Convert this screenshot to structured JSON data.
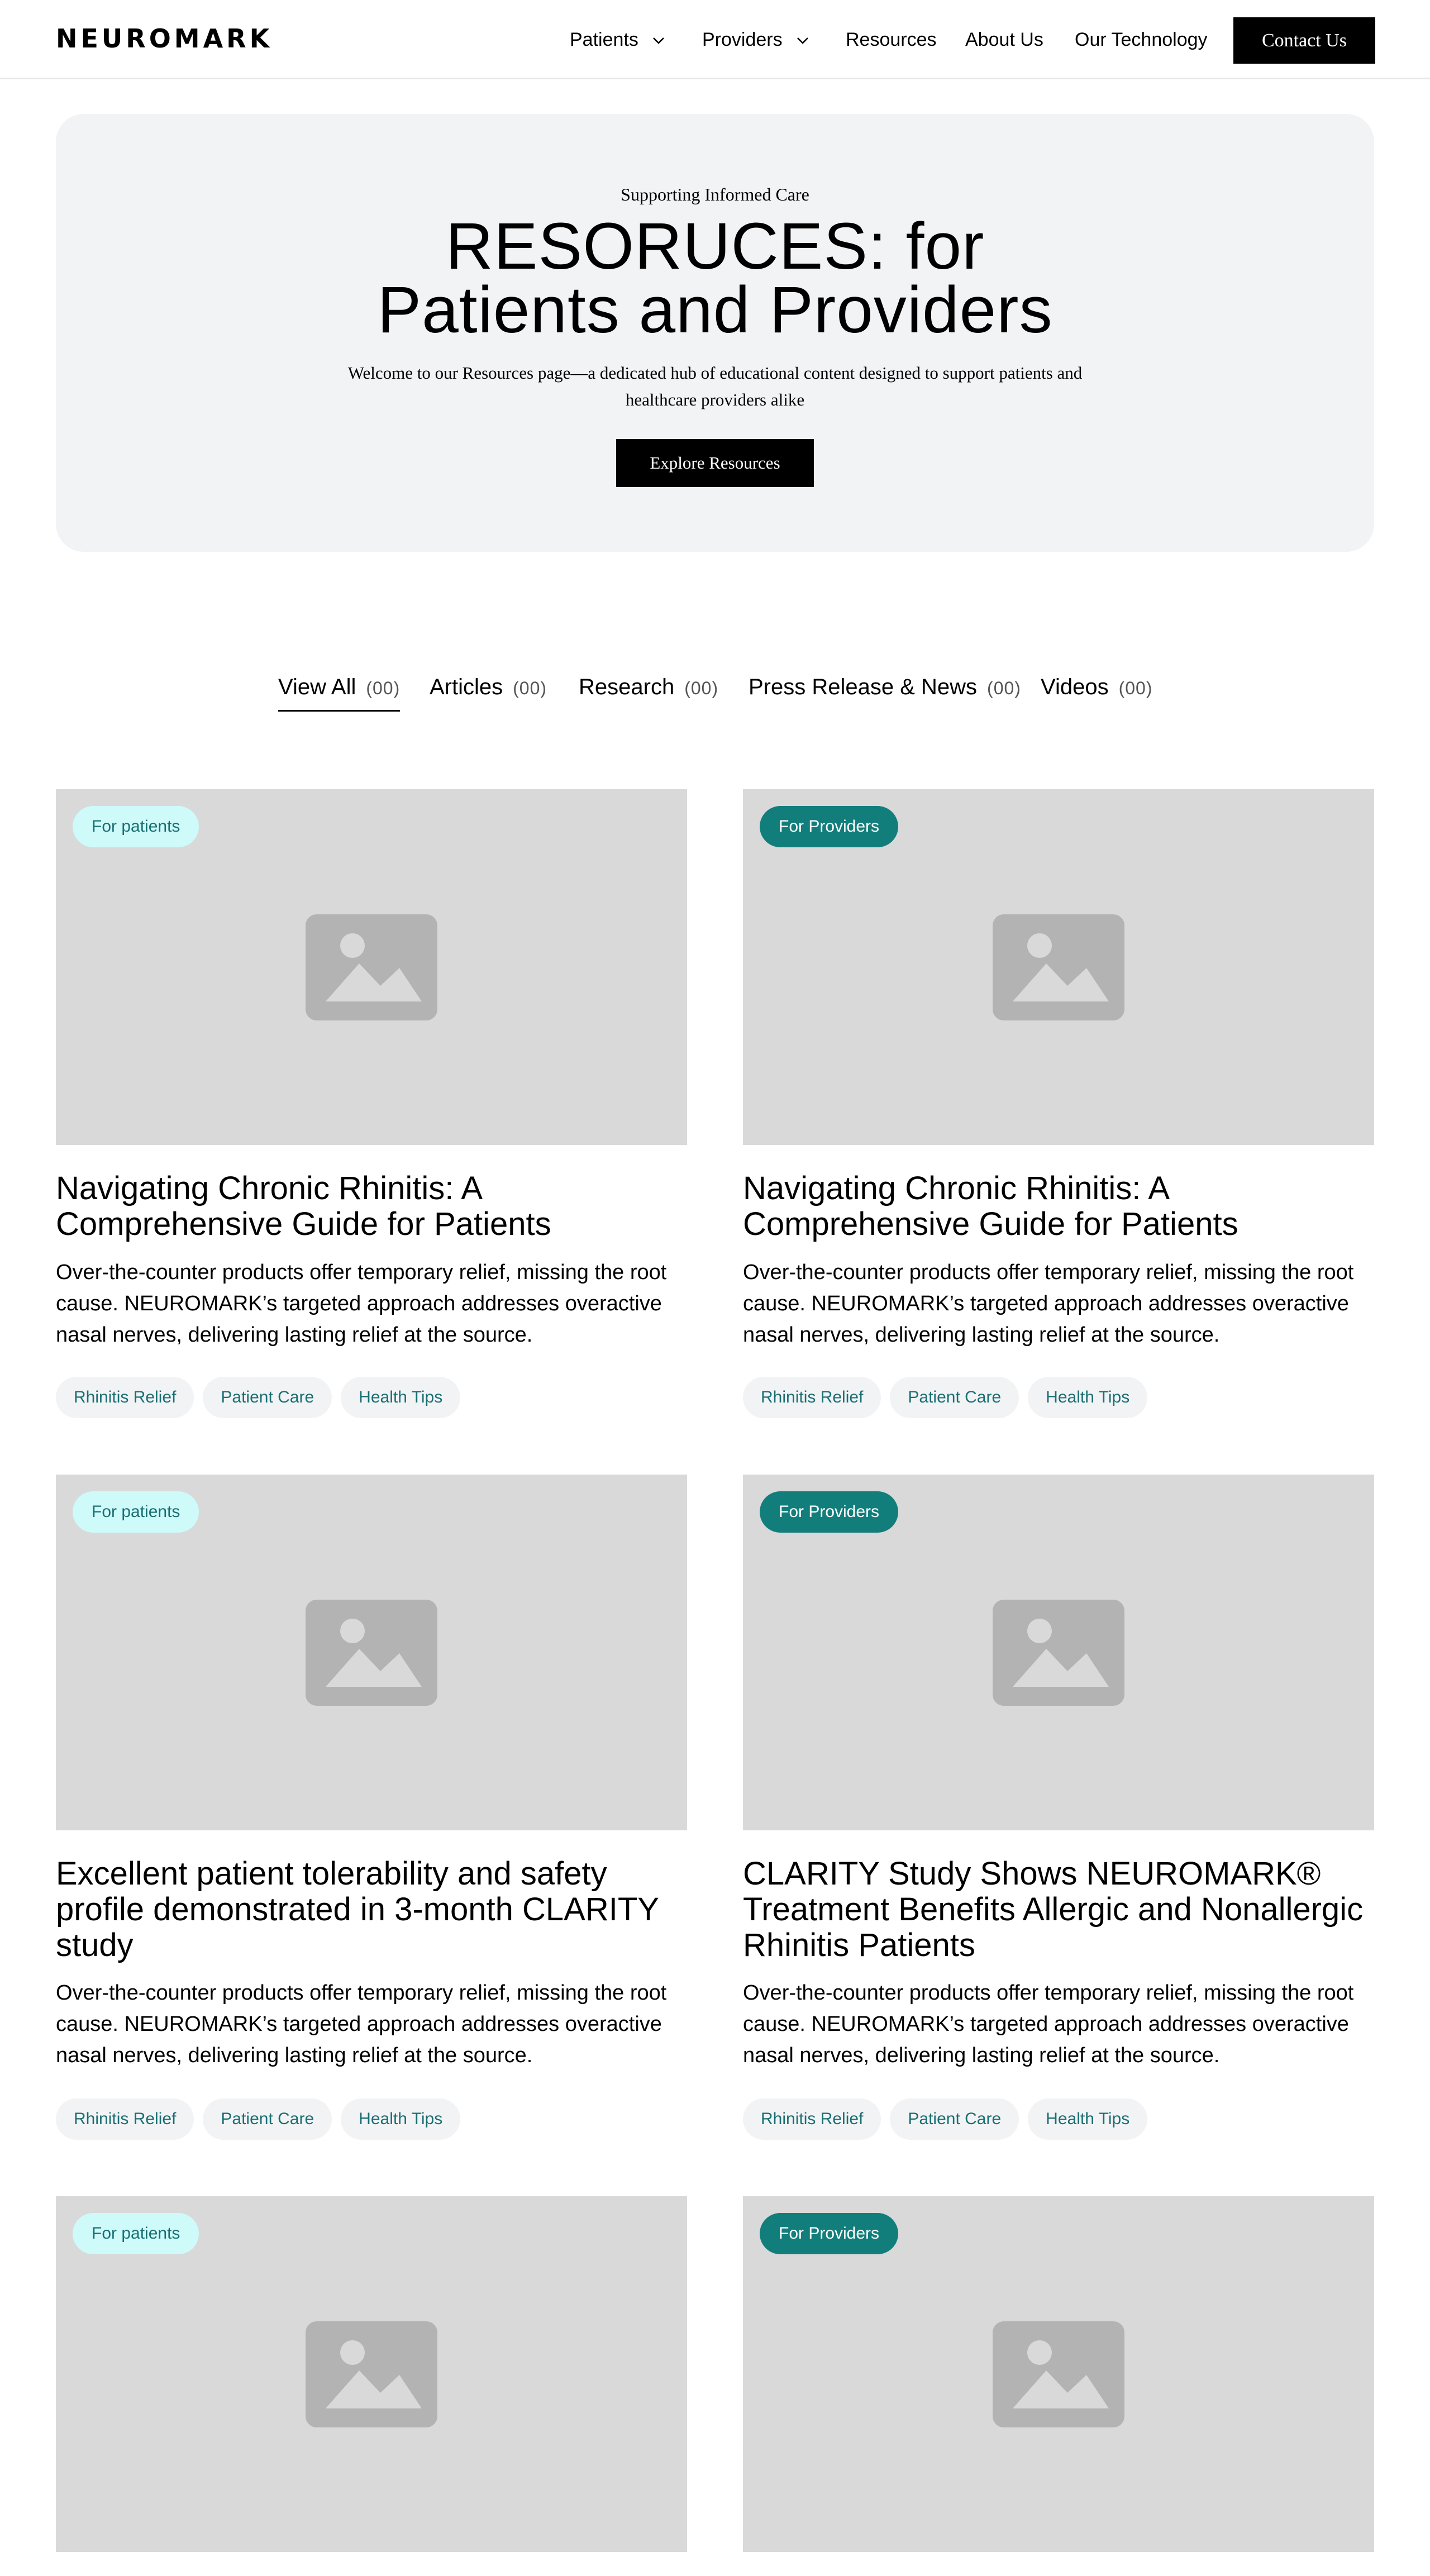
{
  "header": {
    "logo": "NEUROMARK",
    "nav": {
      "patients": "Patients",
      "providers": "Providers",
      "resources": "Resources",
      "about": "About Us",
      "technology": "Our Technology"
    },
    "contact_label": "Contact Us"
  },
  "hero": {
    "kicker": "Supporting Informed Care",
    "title_line1": "RESORUCES: for",
    "title_line2": "Patients and Providers",
    "description": "Welcome to our Resources page—a dedicated hub of educational content designed to support patients and healthcare providers alike",
    "button_label": "Explore Resources"
  },
  "tabs": [
    {
      "label": "View All",
      "count": "(00)"
    },
    {
      "label": "Articles",
      "count": "(00)"
    },
    {
      "label": "Research",
      "count": "(00)"
    },
    {
      "label": "Press Release & News",
      "count": "(00)"
    },
    {
      "label": "Videos",
      "count": "(00)"
    }
  ],
  "cards": [
    {
      "badge": "For patients",
      "title": "Navigating Chronic Rhinitis: A Comprehensive Guide for Patients",
      "description": "Over-the-counter products offer temporary relief, missing the root cause. NEUROMARK’s targeted approach addresses overactive nasal nerves, delivering lasting relief at the source.",
      "tags": [
        "Rhinitis Relief",
        "Patient Care",
        "Health Tips"
      ]
    },
    {
      "badge": "For Providers",
      "title": "Navigating Chronic Rhinitis: A Comprehensive Guide for Patients",
      "description": "Over-the-counter products offer temporary relief, missing the root cause. NEUROMARK’s targeted approach addresses overactive nasal nerves, delivering lasting relief at the source.",
      "tags": [
        "Rhinitis Relief",
        "Patient Care",
        "Health Tips"
      ]
    },
    {
      "badge": "For patients",
      "title": "Excellent patient tolerability and safety profile demonstrated in 3-month CLARITY study",
      "description": "Over-the-counter products offer temporary relief, missing the root cause. NEUROMARK’s targeted approach addresses overactive nasal nerves, delivering lasting relief at the source.",
      "tags": [
        "Rhinitis Relief",
        "Patient Care",
        "Health Tips"
      ]
    },
    {
      "badge": "For Providers",
      "title": "CLARITY Study Shows NEUROMARK® Treatment Benefits Allergic and Nonallergic Rhinitis Patients",
      "description": "Over-the-counter products offer temporary relief, missing the root cause. NEUROMARK’s targeted approach addresses overactive nasal nerves, delivering lasting relief at the source.",
      "tags": [
        "Rhinitis Relief",
        "Patient Care",
        "Health Tips"
      ]
    },
    {
      "badge": "For patients"
    },
    {
      "badge": "For Providers"
    }
  ],
  "colors": {
    "patients_badge_bg": "#cefafa",
    "providers_badge_bg": "#127e7c",
    "tag_text": "#1a6f73",
    "hero_bg": "#f2f3f5",
    "image_placeholder": "#d9d9d9"
  },
  "icons": {
    "chevron": "chevron-down-icon",
    "image_placeholder": "image-placeholder-icon"
  }
}
